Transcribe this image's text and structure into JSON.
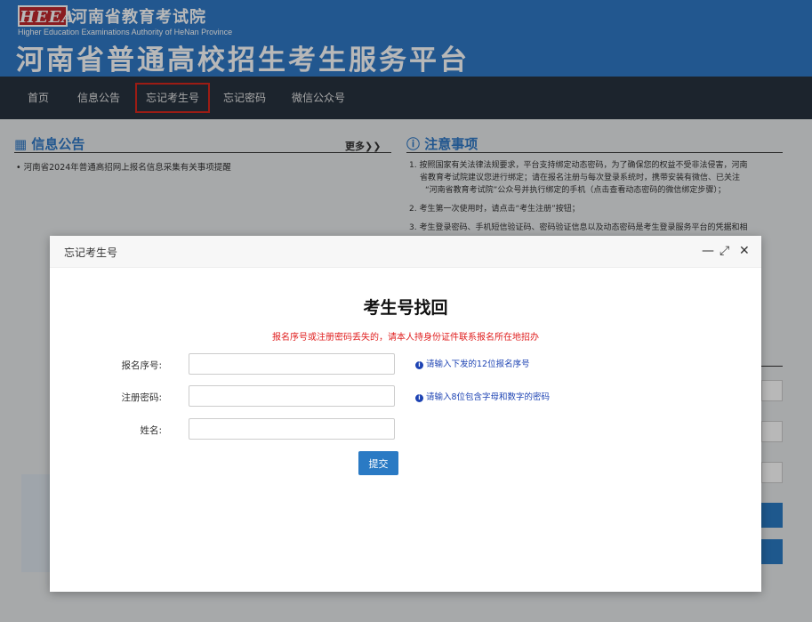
{
  "header": {
    "logo": "HEEA",
    "institution_cn": "河南省教育考试院",
    "institution_en": "Higher Education Examinations Authority of HeNan Province",
    "platform_title": "河南省普通高校招生考生服务平台"
  },
  "nav": {
    "items": [
      "首页",
      "信息公告",
      "忘记考生号",
      "忘记密码",
      "微信公众号"
    ],
    "active": "忘记考生号"
  },
  "info_panel": {
    "title": "信息公告",
    "more": "更多❯❯",
    "news": [
      "河南省2024年普通高招网上报名信息采集有关事项提醒"
    ]
  },
  "notice_panel": {
    "title": "注意事项",
    "items": [
      "1. 按照国家有关法律法规要求，平台支持绑定动态密码，为了确保您的权益不受非法侵害，河南",
      "省教育考试院建议您进行绑定；请在报名注册与每次登录系统时，携带安装有微信、已关注",
      "“河南省教育考试院”公众号并执行绑定的手机（点击查看动态密码的微信绑定步骤）；",
      "2. 考生第一次使用时，请点击“考生注册”按钮；",
      "3. 考生登录密码、手机短信验证码、密码验证信息以及动态密码是考生登录服务平台的凭据和相"
    ]
  },
  "dialog": {
    "window_title": "忘记考生号",
    "controls": {
      "minimize": "—",
      "maximize": "⤢",
      "close": "✕"
    },
    "heading": "考生号找回",
    "warning": "报名序号或注册密码丢失的，请本人持身份证件联系报名所在地招办",
    "fields": [
      {
        "label": "报名序号:",
        "value": "",
        "hint": "请输入下发的12位报名序号"
      },
      {
        "label": "注册密码:",
        "value": "",
        "hint": "请输入8位包含字母和数字的密码"
      },
      {
        "label": "姓名:",
        "value": "",
        "hint": ""
      }
    ],
    "submit_label": "提交"
  },
  "colors": {
    "header_bg": "#3079c6",
    "nav_bg": "#27323f",
    "active_border": "#d9281c",
    "primary_button": "#2a7ac4",
    "warning_text": "#e02020",
    "hint_text": "#1d43b3"
  }
}
